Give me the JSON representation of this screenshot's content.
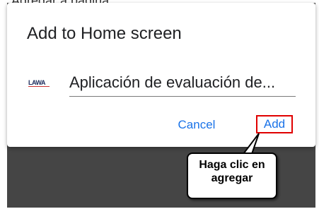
{
  "background_header": {
    "text": "Agregar a pagina"
  },
  "dialog": {
    "title": "Add to Home screen",
    "app_icon_text": "LAWA",
    "name_field_value": "Aplicación de evaluación de...",
    "cancel_label": "Cancel",
    "add_label": "Add"
  },
  "annotation": {
    "callout_text": "Haga clic en agregar",
    "highlight_color": "#e00000"
  },
  "colors": {
    "accent": "#1a73e8",
    "scrim": "#454545"
  }
}
